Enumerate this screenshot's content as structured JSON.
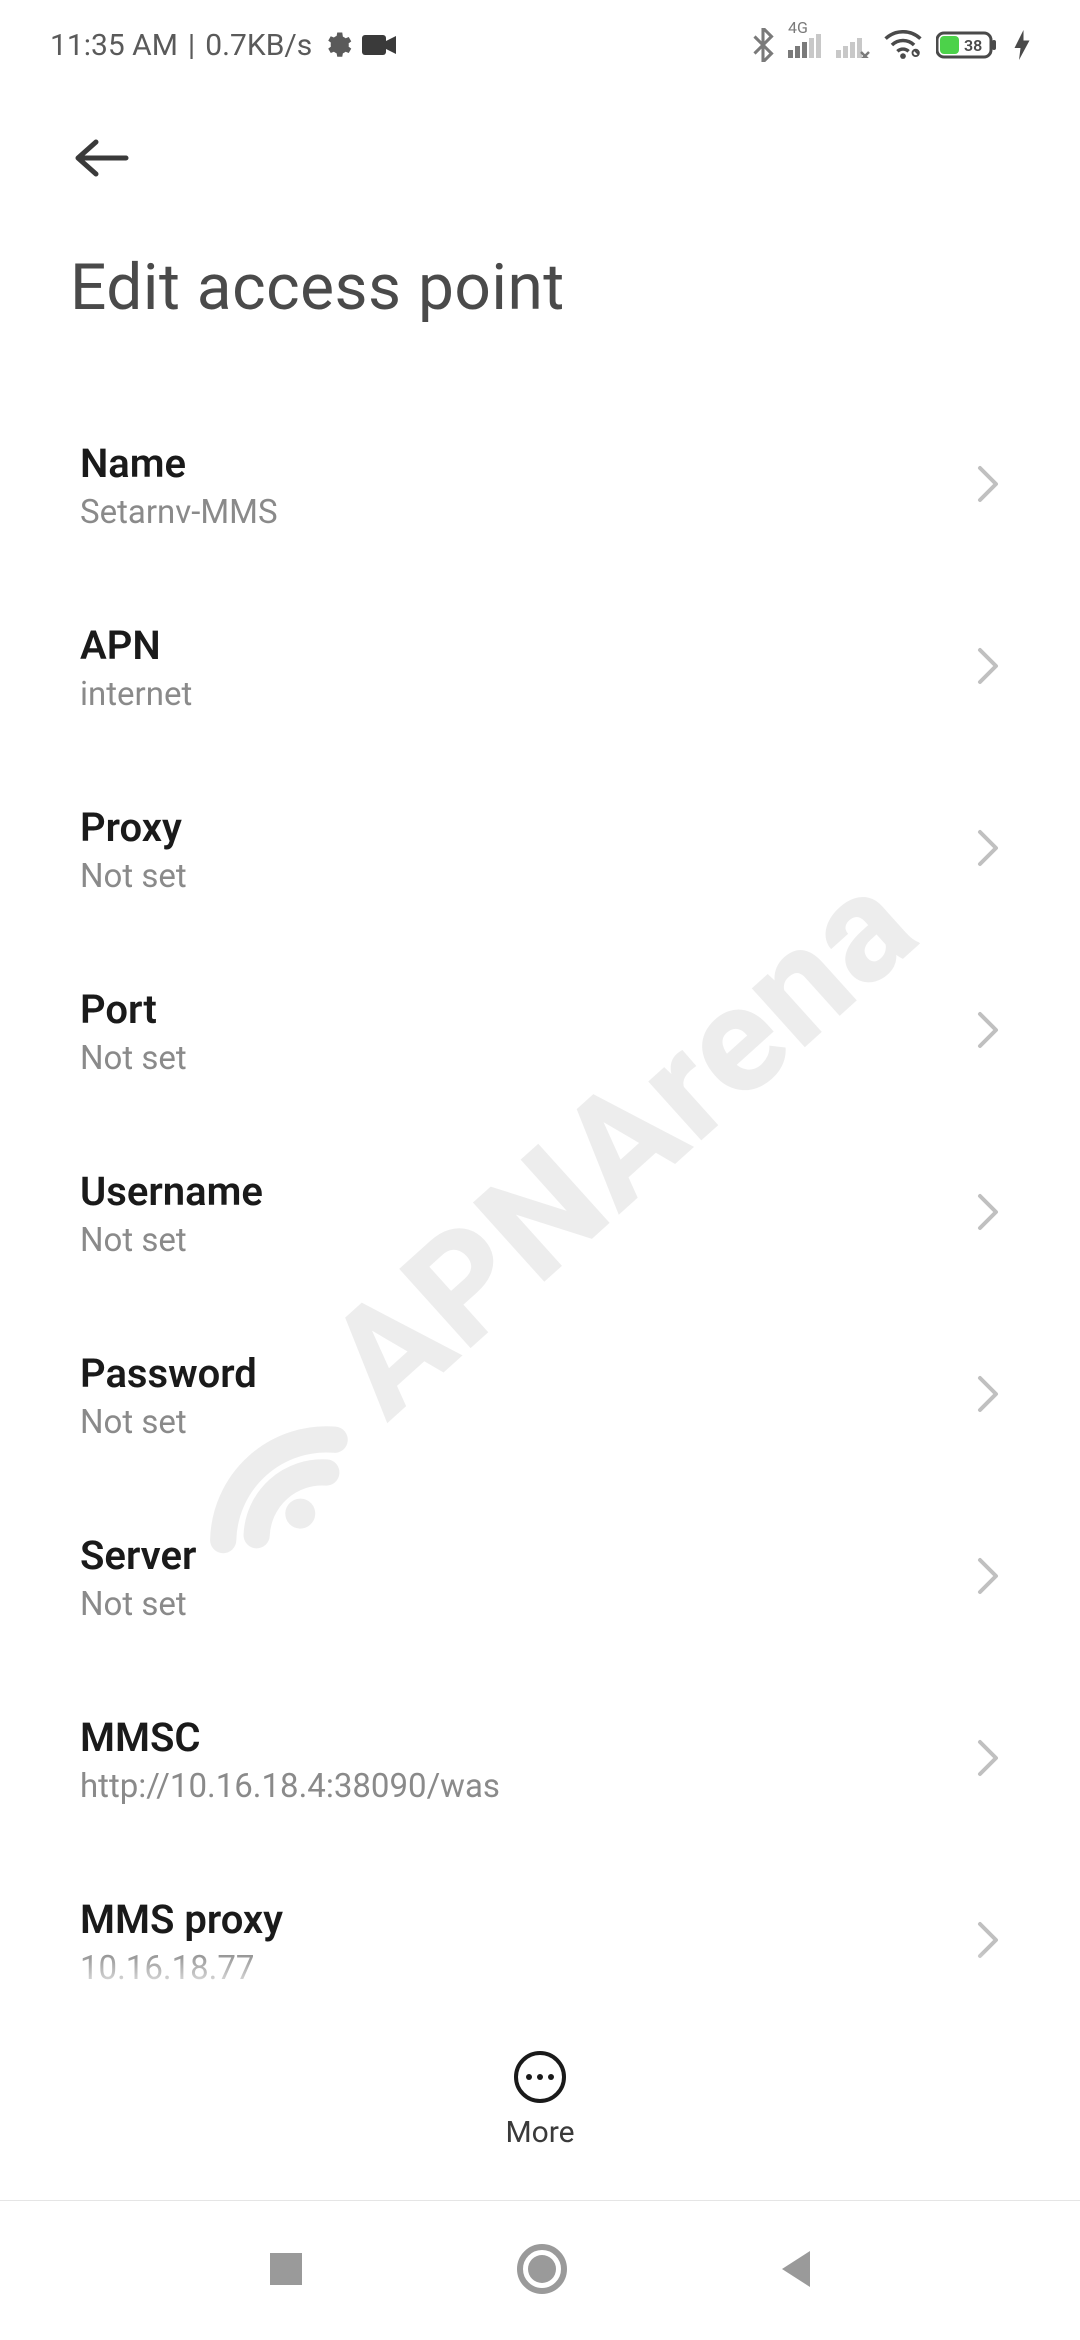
{
  "status": {
    "time": "11:35 AM",
    "net_speed": "0.7KB/s",
    "net_label_4g": "4G",
    "battery_pct": "38"
  },
  "header": {
    "title": "Edit access point"
  },
  "items": [
    {
      "label": "Name",
      "value": "Setarnv-MMS"
    },
    {
      "label": "APN",
      "value": "internet"
    },
    {
      "label": "Proxy",
      "value": "Not set"
    },
    {
      "label": "Port",
      "value": "Not set"
    },
    {
      "label": "Username",
      "value": "Not set"
    },
    {
      "label": "Password",
      "value": "Not set"
    },
    {
      "label": "Server",
      "value": "Not set"
    },
    {
      "label": "MMSC",
      "value": "http://10.16.18.4:38090/was"
    },
    {
      "label": "MMS proxy",
      "value": "10.16.18.77"
    }
  ],
  "bottom": {
    "more_label": "More"
  },
  "watermark": {
    "text": "APNArena"
  }
}
